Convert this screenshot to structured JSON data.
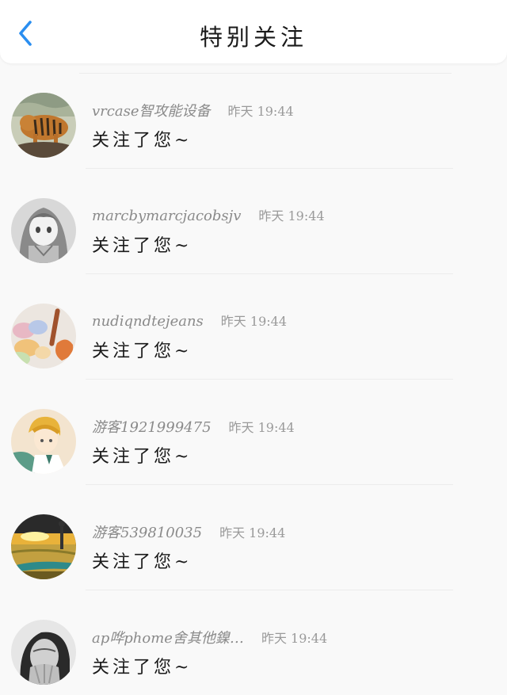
{
  "header": {
    "title": "特别关注",
    "back_icon": "chevron-left-icon",
    "accent": "#2a8ef0"
  },
  "notifications": [
    {
      "name": "vrcase智攻能设备",
      "time": "昨天 19:44",
      "message": "关注了您~",
      "avatar": "tiger-avatar"
    },
    {
      "name": "marcbymarcjacobsjv",
      "time": "昨天 19:44",
      "message": "关注了您~",
      "avatar": "anime-girl-avatar"
    },
    {
      "name": "nudiqndtejeans",
      "time": "昨天 19:44",
      "message": "关注了您~",
      "avatar": "candy-avatar"
    },
    {
      "name": "游客1921999475",
      "time": "昨天 19:44",
      "message": "关注了您~",
      "avatar": "anime-boy-avatar"
    },
    {
      "name": "游客539810035",
      "time": "昨天 19:44",
      "message": "关注了您~",
      "avatar": "sunset-field-avatar"
    },
    {
      "name": "ap哗phome舍其他鎳…",
      "time": "昨天 19:44",
      "message": "关注了您~",
      "avatar": "woman-photo-avatar"
    }
  ]
}
